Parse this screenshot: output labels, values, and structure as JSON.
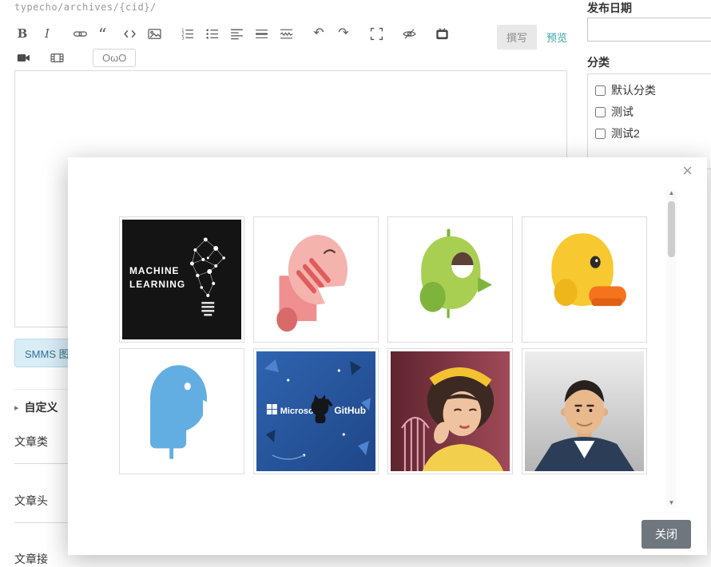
{
  "page": {
    "permalink": "typecho/archives/{cid}/"
  },
  "toolbar": {
    "bold": "B",
    "italic": "I",
    "undo_glyph": "↶",
    "redo_glyph": "↷",
    "emoticon": "OωO",
    "write_tab": "撰写",
    "preview_tab": "预览",
    "icon_names": [
      "link",
      "blockquote",
      "code",
      "image",
      "ordered-list",
      "unordered-list",
      "heading",
      "horizontal-rule",
      "page-break",
      "undo",
      "redo",
      "fullscreen",
      "hide-preview",
      "bilibili",
      "video",
      "keyboard",
      "emoticon"
    ]
  },
  "sidebar": {
    "publish_date_label": "发布日期",
    "publish_date_value": "",
    "category_label": "分类",
    "categories": [
      {
        "label": "默认分类",
        "checked": false
      },
      {
        "label": "测试",
        "checked": false
      },
      {
        "label": "测试2",
        "checked": false
      }
    ]
  },
  "left_panel": {
    "smms_button": "SMMS 图",
    "section_arrow": "▸",
    "custom_fields_header": "自定义",
    "field_labels": [
      "文章类",
      "文章头",
      "文章接"
    ]
  },
  "modal": {
    "close_icon": "×",
    "close_button": "关闭",
    "scroll_up": "▲",
    "scroll_down": "▼",
    "images": [
      {
        "id": "machine-learning-cover",
        "line1": "MACHINE",
        "line2": "LEARNING"
      },
      {
        "id": "pink-bird-illustration"
      },
      {
        "id": "green-bird-illustration"
      },
      {
        "id": "yellow-duck-illustration"
      },
      {
        "id": "blue-bird-illustration"
      },
      {
        "id": "microsoft-github-banner",
        "text1": "Microsoft",
        "text2": "GitHub"
      },
      {
        "id": "girl-portrait-photo"
      },
      {
        "id": "man-portrait-photo"
      }
    ]
  },
  "colors": {
    "accent_teal": "#3aa3a3",
    "info_blue": "#31708f",
    "close_button_gray": "#70767d"
  }
}
